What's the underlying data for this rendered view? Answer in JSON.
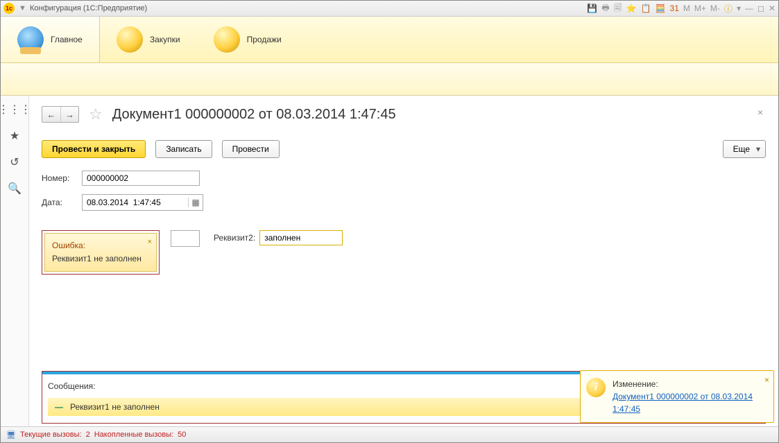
{
  "window": {
    "title": "Конфигурация  (1С:Предприятие)"
  },
  "titlebar_icons": {
    "m": "M",
    "mplus": "M+",
    "mminus": "M-"
  },
  "nav": {
    "main": "Главное",
    "purchases": "Закупки",
    "sales": "Продажи"
  },
  "doc": {
    "title": "Документ1 000000002 от 08.03.2014 1:47:45"
  },
  "buttons": {
    "post_close": "Провести и закрыть",
    "save": "Записать",
    "post": "Провести",
    "more": "Еще"
  },
  "fields": {
    "number_label": "Номер:",
    "number_value": "000000002",
    "date_label": "Дата:",
    "date_value": "08.03.2014  1:47:45",
    "req2_label": "Реквизит2:",
    "req2_value": "заполнен"
  },
  "error_tip": {
    "title": "Ошибка:",
    "text": "Реквизит1 не заполнен"
  },
  "messages": {
    "header": "Сообщения:",
    "item1": "Реквизит1 не заполнен"
  },
  "toast": {
    "title": "Изменение:",
    "link": "Документ1 000000002 от 08.03.2014 1:47:45"
  },
  "status": {
    "calls_label": "Текущие вызовы:",
    "calls_value": "2",
    "accum_label": "Накопленные вызовы:",
    "accum_value": "50"
  }
}
